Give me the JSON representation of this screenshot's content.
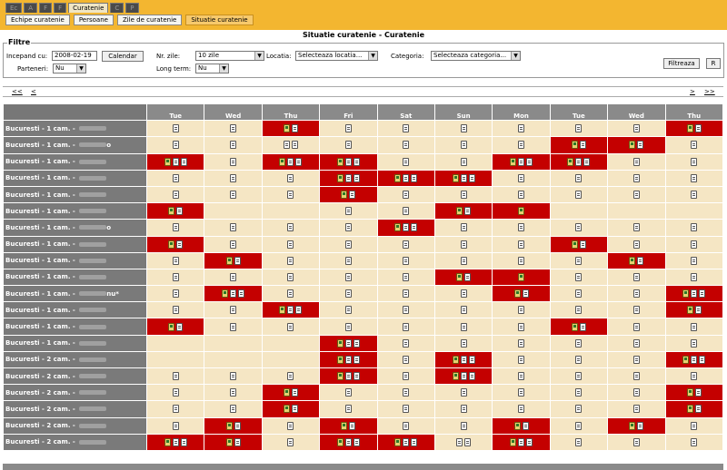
{
  "tabs": [
    {
      "label": "Ec",
      "active": false
    },
    {
      "label": "A",
      "active": false
    },
    {
      "label": "F",
      "active": false
    },
    {
      "label": "F",
      "active": false
    },
    {
      "label": "Curatenie",
      "active": true
    },
    {
      "label": "C",
      "active": false
    },
    {
      "label": "P",
      "active": false
    }
  ],
  "subtabs": [
    {
      "label": "Echipe curatenie",
      "active": false
    },
    {
      "label": "Persoane",
      "active": false
    },
    {
      "label": "Zile de curatenie",
      "active": false
    },
    {
      "label": "Situatie curatenie",
      "active": true
    }
  ],
  "title": "Situatie curatenie - Curatenie",
  "filters": {
    "legend": "Filtre",
    "start_label": "Incepand cu:",
    "start_value": "2008-02-19",
    "calendar_button": "Calendar",
    "nr_zile_label": "Nr. zile:",
    "nr_zile_value": "10 zile",
    "locatia_label": "Locatia:",
    "locatia_value": "Selecteaza locatia...",
    "categoria_label": "Categoria:",
    "categoria_value": "Selecteaza categoria...",
    "parteneri_label": "Parteneri:",
    "parteneri_value": "Nu",
    "longterm_label": "Long term:",
    "longterm_value": "Nu",
    "filtreaza_button": "Filtreaza",
    "r_button": "R"
  },
  "nav": {
    "first": "<<",
    "prev": "<",
    "next": ">",
    "last": ">>"
  },
  "days": [
    "Tue",
    "Wed",
    "Thu",
    "Fri",
    "Sat",
    "Sun",
    "Mon",
    "Tue",
    "Wed",
    "Thu"
  ],
  "rows": [
    {
      "label": "Bucuresti - 1 cam. - ",
      "cells": [
        [
          "w"
        ],
        [
          "w"
        ],
        [
          "r",
          "y",
          "w"
        ],
        [
          "w"
        ],
        [
          "w"
        ],
        [
          "w"
        ],
        [
          "w"
        ],
        [
          "w"
        ],
        [
          "w"
        ],
        [
          "r",
          "y",
          "w"
        ]
      ]
    },
    {
      "label": "Bucuresti - 1 cam. - ",
      "suffix": "o",
      "cells": [
        [
          "w"
        ],
        [
          "w"
        ],
        [
          "w",
          "w"
        ],
        [
          "w"
        ],
        [
          "w"
        ],
        [
          "w"
        ],
        [
          "w"
        ],
        [
          "r",
          "y",
          "w"
        ],
        [
          "r",
          "y",
          "w"
        ],
        [
          "w"
        ]
      ]
    },
    {
      "label": "Bucuresti - 1 cam. - ",
      "cells": [
        [
          "r",
          "y",
          "w",
          "w"
        ],
        [
          "w"
        ],
        [
          "r",
          "y",
          "w",
          "w"
        ],
        [
          "r",
          "y",
          "w",
          "w"
        ],
        [
          "w"
        ],
        [
          "w"
        ],
        [
          "r",
          "y",
          "w",
          "w"
        ],
        [
          "r",
          "y",
          "w",
          "w"
        ],
        [
          "w"
        ],
        [
          "w"
        ]
      ]
    },
    {
      "label": "Bucuresti - 1 cam. - ",
      "cells": [
        [
          "w"
        ],
        [
          "w"
        ],
        [
          "w"
        ],
        [
          "r",
          "y",
          "w",
          "w"
        ],
        [
          "r",
          "y",
          "w",
          "w"
        ],
        [
          "r",
          "y",
          "w",
          "w"
        ],
        [
          "w"
        ],
        [
          "w"
        ],
        [
          "w"
        ],
        [
          "w"
        ]
      ]
    },
    {
      "label": "Bucuresti - 1 cam. - ",
      "cells": [
        [
          "w"
        ],
        [
          "w"
        ],
        [
          "w"
        ],
        [
          "r",
          "y",
          "w"
        ],
        [
          "w"
        ],
        [
          "w"
        ],
        [
          "w"
        ],
        [
          "w"
        ],
        [
          "w"
        ],
        [
          "w"
        ]
      ]
    },
    {
      "label": "Bucuresti - 1 cam. - ",
      "cells": [
        [
          "r",
          "y",
          "w"
        ],
        [
          "e"
        ],
        [
          "e"
        ],
        [
          "w"
        ],
        [
          "w"
        ],
        [
          "r",
          "y",
          "w"
        ],
        [
          "r",
          "y"
        ],
        [
          "e"
        ],
        [
          "e"
        ],
        [
          "e"
        ]
      ]
    },
    {
      "label": "Bucuresti - 1 cam. - ",
      "suffix": "o",
      "cells": [
        [
          "w"
        ],
        [
          "w"
        ],
        [
          "w"
        ],
        [
          "w"
        ],
        [
          "r",
          "y",
          "w",
          "w"
        ],
        [
          "w"
        ],
        [
          "w"
        ],
        [
          "w"
        ],
        [
          "w"
        ],
        [
          "w"
        ]
      ]
    },
    {
      "label": "Bucuresti - 1 cam. - ",
      "cells": [
        [
          "r",
          "y",
          "w"
        ],
        [
          "w"
        ],
        [
          "w"
        ],
        [
          "w"
        ],
        [
          "w"
        ],
        [
          "w"
        ],
        [
          "w"
        ],
        [
          "r",
          "y",
          "w"
        ],
        [
          "w"
        ],
        [
          "w"
        ]
      ]
    },
    {
      "label": "Bucuresti - 1 cam. - ",
      "cells": [
        [
          "w"
        ],
        [
          "r",
          "y",
          "w"
        ],
        [
          "w"
        ],
        [
          "w"
        ],
        [
          "w"
        ],
        [
          "w"
        ],
        [
          "w"
        ],
        [
          "w"
        ],
        [
          "r",
          "y",
          "w"
        ],
        [
          "w"
        ]
      ]
    },
    {
      "label": "Bucuresti - 1 cam. - ",
      "cells": [
        [
          "w"
        ],
        [
          "w"
        ],
        [
          "w"
        ],
        [
          "w"
        ],
        [
          "w"
        ],
        [
          "r",
          "y",
          "w"
        ],
        [
          "r",
          "y"
        ],
        [
          "w"
        ],
        [
          "w"
        ],
        [
          "w"
        ]
      ]
    },
    {
      "label": "Bucuresti - 1 cam. - ",
      "suffix": "nu*",
      "cells": [
        [
          "w"
        ],
        [
          "r",
          "y",
          "w",
          "w"
        ],
        [
          "w"
        ],
        [
          "w"
        ],
        [
          "w"
        ],
        [
          "w"
        ],
        [
          "r",
          "y",
          "w"
        ],
        [
          "w"
        ],
        [
          "w"
        ],
        [
          "r",
          "y",
          "w",
          "w"
        ]
      ]
    },
    {
      "label": "Bucuresti - 1 cam. - ",
      "cells": [
        [
          "w"
        ],
        [
          "w"
        ],
        [
          "r",
          "y",
          "w",
          "w"
        ],
        [
          "w"
        ],
        [
          "w"
        ],
        [
          "w"
        ],
        [
          "w"
        ],
        [
          "w"
        ],
        [
          "w"
        ],
        [
          "r",
          "y",
          "w"
        ]
      ]
    },
    {
      "label": "Bucuresti - 1 cam. - ",
      "cells": [
        [
          "r",
          "y",
          "w"
        ],
        [
          "w"
        ],
        [
          "w"
        ],
        [
          "w"
        ],
        [
          "w"
        ],
        [
          "w"
        ],
        [
          "w"
        ],
        [
          "r",
          "y",
          "w"
        ],
        [
          "w"
        ],
        [
          "w"
        ]
      ]
    },
    {
      "label": "Bucuresti - 1 cam. - ",
      "cells": [
        [
          "e"
        ],
        [
          "e"
        ],
        [
          "e"
        ],
        [
          "r",
          "y",
          "w",
          "w"
        ],
        [
          "w"
        ],
        [
          "w"
        ],
        [
          "w"
        ],
        [
          "w"
        ],
        [
          "w"
        ],
        [
          "w"
        ]
      ]
    },
    {
      "label": "Bucuresti - 2 cam. - ",
      "cells": [
        [
          "e"
        ],
        [
          "e"
        ],
        [
          "e"
        ],
        [
          "r",
          "y",
          "w",
          "w"
        ],
        [
          "w"
        ],
        [
          "r",
          "y",
          "w",
          "w"
        ],
        [
          "w"
        ],
        [
          "w"
        ],
        [
          "w"
        ],
        [
          "r",
          "y",
          "w",
          "w"
        ]
      ]
    },
    {
      "label": "Bucuresti - 2 cam. - ",
      "cells": [
        [
          "w"
        ],
        [
          "w"
        ],
        [
          "w"
        ],
        [
          "r",
          "y",
          "w",
          "w"
        ],
        [
          "w"
        ],
        [
          "r",
          "y",
          "w",
          "w"
        ],
        [
          "w"
        ],
        [
          "w"
        ],
        [
          "w"
        ],
        [
          "w"
        ]
      ]
    },
    {
      "label": "Bucuresti - 2 cam. - ",
      "cells": [
        [
          "w"
        ],
        [
          "w"
        ],
        [
          "r",
          "y",
          "w"
        ],
        [
          "w"
        ],
        [
          "w"
        ],
        [
          "w"
        ],
        [
          "w"
        ],
        [
          "w"
        ],
        [
          "w"
        ],
        [
          "r",
          "y",
          "w"
        ]
      ]
    },
    {
      "label": "Bucuresti - 2 cam. - ",
      "cells": [
        [
          "w"
        ],
        [
          "w"
        ],
        [
          "r",
          "y",
          "w"
        ],
        [
          "w"
        ],
        [
          "w"
        ],
        [
          "w"
        ],
        [
          "w"
        ],
        [
          "w"
        ],
        [
          "w"
        ],
        [
          "r",
          "y",
          "w"
        ]
      ]
    },
    {
      "label": "Bucuresti - 2 cam. - ",
      "cells": [
        [
          "w"
        ],
        [
          "r",
          "y",
          "w"
        ],
        [
          "w"
        ],
        [
          "r",
          "y",
          "w"
        ],
        [
          "w"
        ],
        [
          "w"
        ],
        [
          "r",
          "y",
          "w"
        ],
        [
          "w"
        ],
        [
          "r",
          "y",
          "w"
        ],
        [
          "w"
        ]
      ]
    },
    {
      "label": "Bucuresti - 2 cam. - ",
      "cells": [
        [
          "r",
          "y",
          "w",
          "w"
        ],
        [
          "r",
          "y",
          "w"
        ],
        [
          "w"
        ],
        [
          "r",
          "y",
          "w",
          "w"
        ],
        [
          "r",
          "y",
          "w",
          "w"
        ],
        [
          "w",
          "w"
        ],
        [
          "r",
          "y",
          "w",
          "w"
        ],
        [
          "w"
        ],
        [
          "w"
        ],
        [
          "w"
        ]
      ]
    }
  ]
}
